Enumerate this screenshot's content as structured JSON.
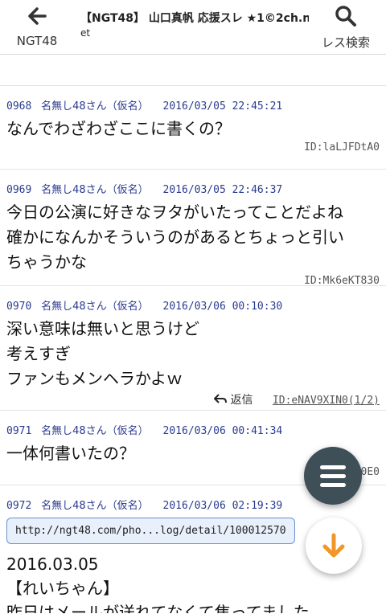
{
  "header": {
    "back_label": "NGT48",
    "title_line1": "【NGT48】 山口真帆 応援スレ ★1©2ch.n",
    "title_line2": "et",
    "search_label": "レス検索"
  },
  "posts": [
    {
      "num": "0968",
      "name": "名無し48さん（仮名）",
      "date": "2016/03/05 22:45:21",
      "lines": [
        "なんでわざわざここに書くの？"
      ],
      "id": "ID:laLJFDtA0"
    },
    {
      "num": "0969",
      "name": "名無し48さん（仮名）",
      "date": "2016/03/05 22:46:37",
      "lines": [
        "今日の公演に好きなヲタがいたってことだよね",
        "確かになんかそういうのがあるとちょっと引い",
        "ちゃうかな"
      ],
      "id": "ID:Mk6eKT830"
    },
    {
      "num": "0970",
      "name": "名無し48さん（仮名）",
      "date": "2016/03/06 00:10:30",
      "lines": [
        "深い意味は無いと思うけど",
        "考えすぎ",
        "ファンもメンヘラかよｗ"
      ],
      "reply_label": "返信",
      "id": "ID:eNAV9XIN0(1/2)"
    },
    {
      "num": "0971",
      "name": "名無し48さん（仮名）",
      "date": "2016/03/06 00:41:34",
      "lines": [
        "一体何書いたの？"
      ],
      "id": "0E0"
    },
    {
      "num": "0972",
      "name": "名無し48さん（仮名）",
      "date": "2016/03/06 02:19:39",
      "url": "http://ngt48.com/pho...log/detail/100012570",
      "date_line": "2016.03.05",
      "bracket_line": "【れいちゃん】",
      "cut_line": "昨日はメールが送れてなくて焦ってました"
    }
  ],
  "colors": {
    "accent": "#2b3b8f",
    "fab": "#3f4f58",
    "arrow": "#f0962a"
  },
  "icons": {
    "back": "arrow-left-icon",
    "search": "search-icon",
    "menu": "menu-icon",
    "down": "arrow-down-icon",
    "reply": "reply-icon"
  }
}
